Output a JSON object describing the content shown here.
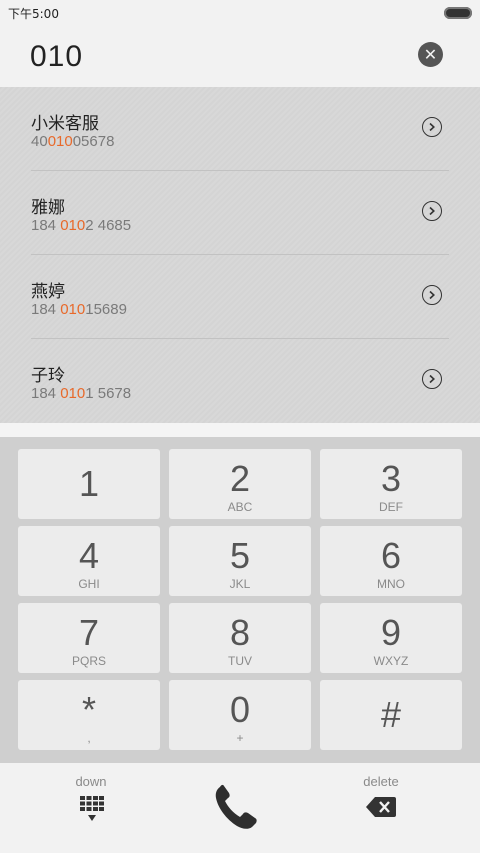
{
  "status_bar": {
    "time": "下午5:00"
  },
  "dialer": {
    "input": "010"
  },
  "results": [
    {
      "name": "小米客服",
      "number_parts": [
        "40",
        "010",
        "05678"
      ]
    },
    {
      "name": "雅娜",
      "number_parts": [
        "184 ",
        "010",
        "2 4685"
      ]
    },
    {
      "name": "燕婷",
      "number_parts": [
        "184 ",
        "010",
        "15689"
      ]
    },
    {
      "name": "子玲",
      "number_parts": [
        "184 ",
        "010",
        "1 5678"
      ]
    }
  ],
  "keys": [
    {
      "digit": "1",
      "letters": ""
    },
    {
      "digit": "2",
      "letters": "ABC"
    },
    {
      "digit": "3",
      "letters": "DEF"
    },
    {
      "digit": "4",
      "letters": "GHI"
    },
    {
      "digit": "5",
      "letters": "JKL"
    },
    {
      "digit": "6",
      "letters": "MNO"
    },
    {
      "digit": "7",
      "letters": "PQRS"
    },
    {
      "digit": "8",
      "letters": "TUV"
    },
    {
      "digit": "9",
      "letters": "WXYZ"
    },
    {
      "digit": "*",
      "letters": ","
    },
    {
      "digit": "0",
      "letters": "+"
    },
    {
      "digit": "#",
      "letters": ""
    }
  ],
  "bottom_bar": {
    "down_label": "down",
    "delete_label": "delete"
  },
  "colors": {
    "highlight": "#e8692a"
  },
  "icons": [
    "close-icon",
    "chevron-right-icon",
    "keypad-grid-icon",
    "phone-icon",
    "backspace-icon"
  ]
}
